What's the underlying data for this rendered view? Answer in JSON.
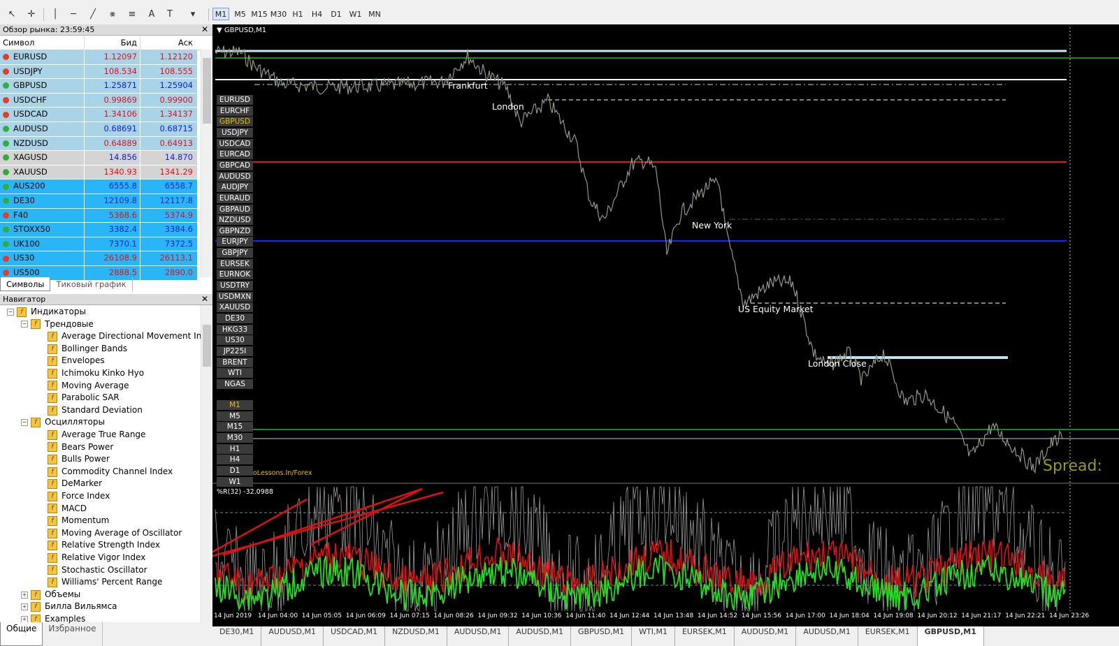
{
  "toolbar": {
    "timeframes": [
      "M1",
      "M5",
      "M15",
      "M30",
      "H1",
      "H4",
      "D1",
      "W1",
      "MN"
    ],
    "active_timeframe": "M1"
  },
  "market_watch": {
    "title": "Обзор рынка: 23:59:45",
    "columns": [
      "Символ",
      "Бид",
      "Аск"
    ],
    "rows": [
      {
        "symbol": "EURUSD",
        "bid": "1.12097",
        "ask": "1.12120",
        "dir": "dn",
        "bg": "#a9d4e8",
        "bid_color": "red",
        "ask_color": "red"
      },
      {
        "symbol": "USDJPY",
        "bid": "108.534",
        "ask": "108.555",
        "dir": "dn",
        "bg": "#a9d4e8",
        "bid_color": "red",
        "ask_color": "red"
      },
      {
        "symbol": "GBPUSD",
        "bid": "1.25871",
        "ask": "1.25904",
        "dir": "up",
        "bg": "#a9d4e8",
        "bid_color": "blue",
        "ask_color": "blue"
      },
      {
        "symbol": "USDCHF",
        "bid": "0.99869",
        "ask": "0.99900",
        "dir": "dn",
        "bg": "#a9d4e8",
        "bid_color": "red",
        "ask_color": "red"
      },
      {
        "symbol": "USDCAD",
        "bid": "1.34106",
        "ask": "1.34137",
        "dir": "dn",
        "bg": "#a9d4e8",
        "bid_color": "red",
        "ask_color": "red"
      },
      {
        "symbol": "AUDUSD",
        "bid": "0.68691",
        "ask": "0.68715",
        "dir": "up",
        "bg": "#a9d4e8",
        "bid_color": "blue",
        "ask_color": "blue"
      },
      {
        "symbol": "NZDUSD",
        "bid": "0.64889",
        "ask": "0.64913",
        "dir": "up",
        "bg": "#a9d4e8",
        "bid_color": "red",
        "ask_color": "red"
      },
      {
        "symbol": "XAGUSD",
        "bid": "14.856",
        "ask": "14.870",
        "dir": "up",
        "bg": "#d4d4d4",
        "bid_color": "blue",
        "ask_color": "blue"
      },
      {
        "symbol": "XAUUSD",
        "bid": "1340.93",
        "ask": "1341.29",
        "dir": "up",
        "bg": "#d4d4d4",
        "bid_color": "red",
        "ask_color": "red"
      },
      {
        "symbol": "AUS200",
        "bid": "6555.8",
        "ask": "6558.7",
        "dir": "up",
        "bg": "#29b6f6",
        "bid_color": "blue",
        "ask_color": "blue"
      },
      {
        "symbol": "DE30",
        "bid": "12109.8",
        "ask": "12117.8",
        "dir": "up",
        "bg": "#29b6f6",
        "bid_color": "blue",
        "ask_color": "blue"
      },
      {
        "symbol": "F40",
        "bid": "5368.6",
        "ask": "5374.9",
        "dir": "dn",
        "bg": "#29b6f6",
        "bid_color": "red",
        "ask_color": "red"
      },
      {
        "symbol": "STOXX50",
        "bid": "3382.4",
        "ask": "3384.6",
        "dir": "up",
        "bg": "#29b6f6",
        "bid_color": "blue",
        "ask_color": "blue"
      },
      {
        "symbol": "UK100",
        "bid": "7370.1",
        "ask": "7372.5",
        "dir": "up",
        "bg": "#29b6f6",
        "bid_color": "blue",
        "ask_color": "blue"
      },
      {
        "symbol": "US30",
        "bid": "26108.9",
        "ask": "26113.1",
        "dir": "dn",
        "bg": "#29b6f6",
        "bid_color": "red",
        "ask_color": "red"
      },
      {
        "symbol": "US500",
        "bid": "2888.5",
        "ask": "2890.0",
        "dir": "dn",
        "bg": "#29b6f6",
        "bid_color": "red",
        "ask_color": "red"
      }
    ],
    "tabs": [
      "Символы",
      "Тиковый график"
    ]
  },
  "navigator": {
    "title": "Навигатор",
    "root": "Индикаторы",
    "groups": [
      {
        "label": "Трендовые",
        "items": [
          "Average Directional Movement Index",
          "Bollinger Bands",
          "Envelopes",
          "Ichimoku Kinko Hyo",
          "Moving Average",
          "Parabolic SAR",
          "Standard Deviation"
        ]
      },
      {
        "label": "Осцилляторы",
        "items": [
          "Average True Range",
          "Bears Power",
          "Bulls Power",
          "Commodity Channel Index",
          "DeMarker",
          "Force Index",
          "MACD",
          "Momentum",
          "Moving Average of Oscillator",
          "Relative Strength Index",
          "Relative Vigor Index",
          "Stochastic Oscillator",
          "Williams' Percent Range"
        ]
      }
    ],
    "collapsed": [
      "Объемы",
      "Билла Вильямса",
      "Examples"
    ],
    "tabs": [
      "Общие",
      "Избранное"
    ]
  },
  "chart": {
    "title": "GBPUSD,M1",
    "symbols": [
      "EURUSD",
      "EURCHF",
      "GBPUSD",
      "USDJPY",
      "USDCAD",
      "EURCAD",
      "GBPCAD",
      "AUDUSD",
      "AUDJPY",
      "EURAUD",
      "GBPAUD",
      "NZDUSD",
      "GBPNZD",
      "EURJPY",
      "GBPJPY",
      "EURSEK",
      "EURNOK",
      "USDTRY",
      "USDMXN",
      "XAUUSD",
      "DE30",
      "HKG33",
      "US30",
      "JP225I",
      "BRENT",
      "WTI",
      "NGAS"
    ],
    "selected_symbol": "GBPUSD",
    "timeframes": [
      "M1",
      "M5",
      "M15",
      "M30",
      "H1",
      "H4",
      "D1",
      "W1"
    ],
    "selected_timeframe": "M1",
    "sessions": [
      "Frankfurt",
      "London",
      "New York",
      "US Equity Market",
      "London Close"
    ],
    "watermark": "oLessons.In/Forex",
    "spread_label": "Spread:",
    "indicator_label": "%R(32) -32.0988",
    "time_axis": [
      "14 Jun 2019",
      "14 Jun 04:00",
      "14 Jun 05:05",
      "14 Jun 06:09",
      "14 Jun 07:15",
      "14 Jun 08:26",
      "14 Jun 09:32",
      "14 Jun 10:36",
      "14 Jun 11:40",
      "14 Jun 12:44",
      "14 Jun 13:48",
      "14 Jun 14:52",
      "14 Jun 15:56",
      "14 Jun 17:00",
      "14 Jun 18:04",
      "14 Jun 19:08",
      "14 Jun 20:12",
      "14 Jun 21:17",
      "14 Jun 22:21",
      "14 Jun 23:26"
    ]
  },
  "bottom_tabs": [
    "DE30,M1",
    "AUDUSD,M1",
    "USDCAD,M1",
    "NZDUSD,M1",
    "AUDUSD,M1",
    "AUDUSD,M1",
    "GBPUSD,M1",
    "WTI,M1",
    "EURSEK,M1",
    "AUDUSD,M1",
    "AUDUSD,M1",
    "EURSEK,M1",
    "GBPUSD,M1"
  ],
  "active_bottom_tab": "GBPUSD,M1"
}
